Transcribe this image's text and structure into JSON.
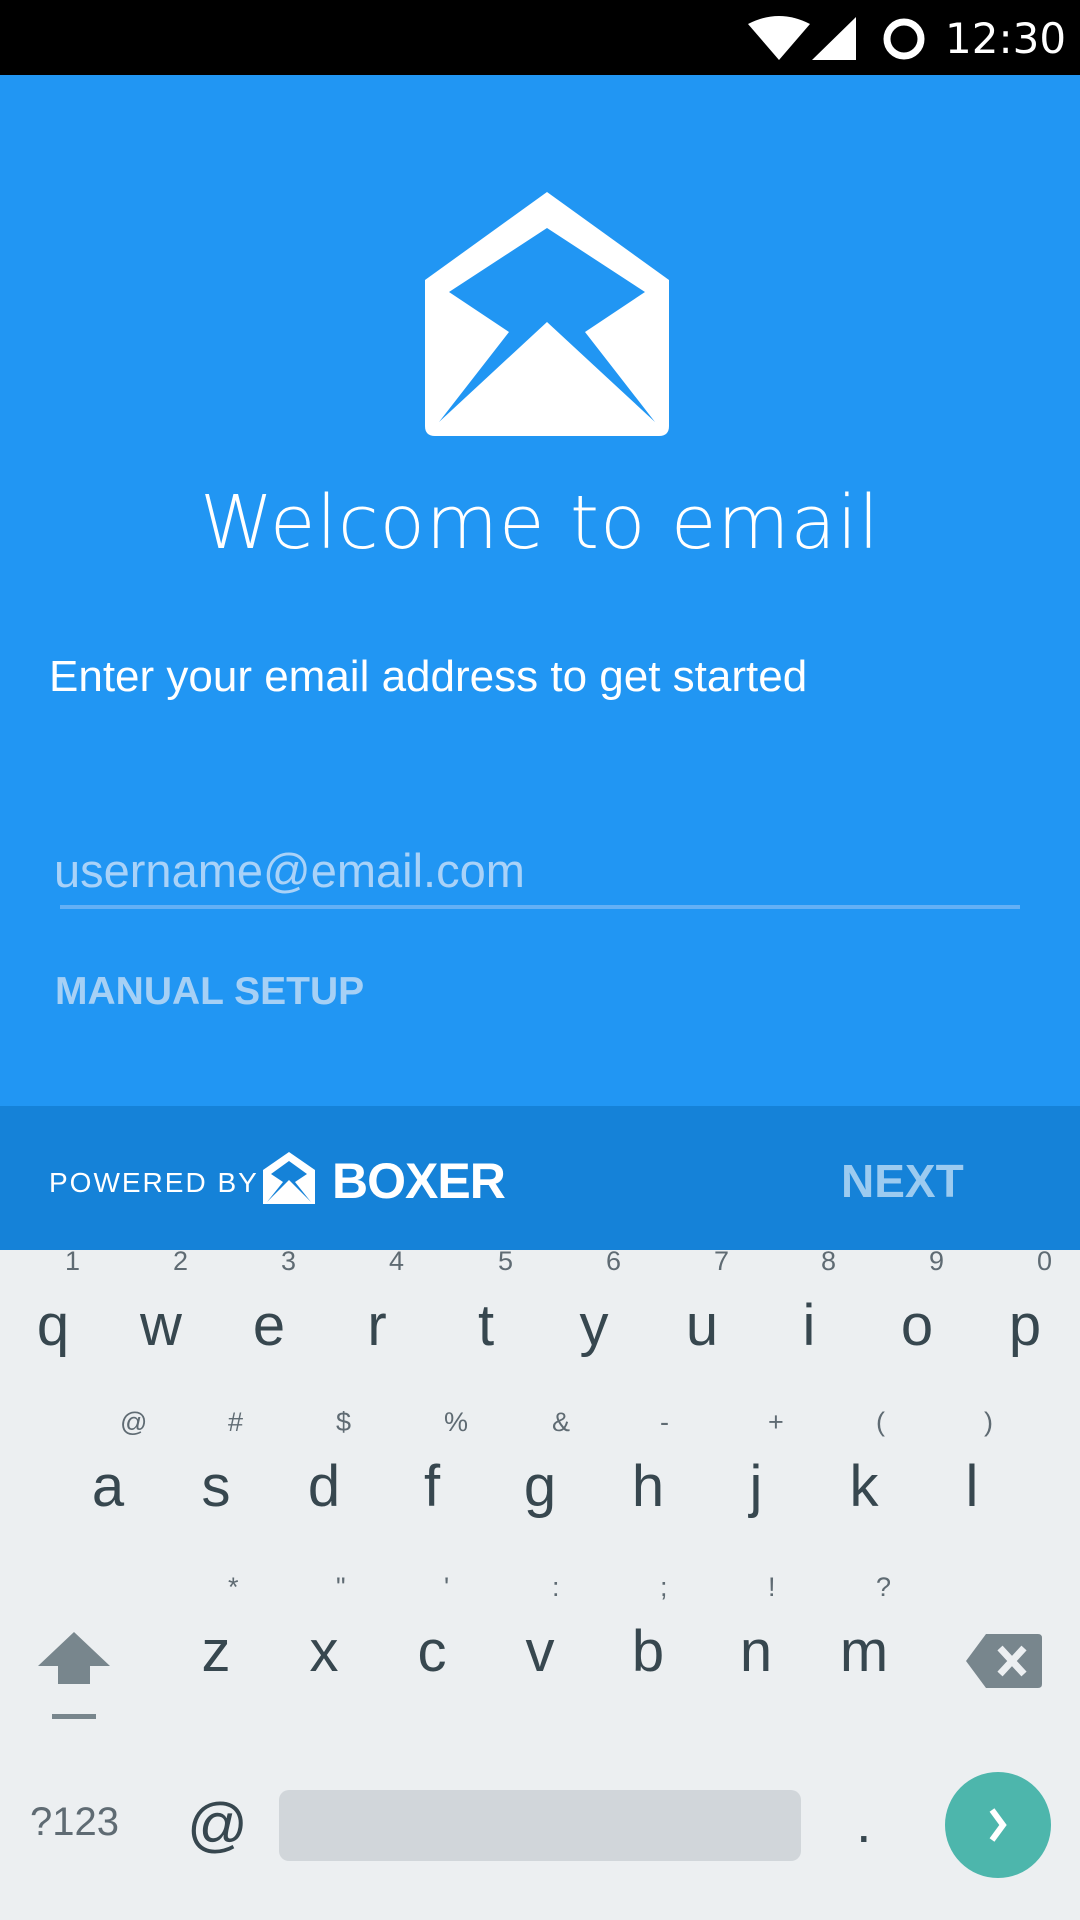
{
  "status_bar": {
    "time": "12:30",
    "icons": [
      "wifi-icon",
      "cell-signal-icon",
      "circle-icon"
    ]
  },
  "main": {
    "title": "Welcome to email",
    "subtitle": "Enter your email address to get started",
    "email_placeholder": "username@email.com",
    "manual_setup": "MANUAL SETUP"
  },
  "footer": {
    "powered_by": "POWERED BY",
    "brand": "BOXER",
    "next": "NEXT"
  },
  "keyboard": {
    "row1": [
      {
        "k": "q",
        "h": "1"
      },
      {
        "k": "w",
        "h": "2"
      },
      {
        "k": "e",
        "h": "3"
      },
      {
        "k": "r",
        "h": "4"
      },
      {
        "k": "t",
        "h": "5"
      },
      {
        "k": "y",
        "h": "6"
      },
      {
        "k": "u",
        "h": "7"
      },
      {
        "k": "i",
        "h": "8"
      },
      {
        "k": "o",
        "h": "9"
      },
      {
        "k": "p",
        "h": "0"
      }
    ],
    "row2": [
      {
        "k": "a",
        "h": "@"
      },
      {
        "k": "s",
        "h": "#"
      },
      {
        "k": "d",
        "h": "$"
      },
      {
        "k": "f",
        "h": "%"
      },
      {
        "k": "g",
        "h": "&"
      },
      {
        "k": "h",
        "h": "-"
      },
      {
        "k": "j",
        "h": "+"
      },
      {
        "k": "k",
        "h": "("
      },
      {
        "k": "l",
        "h": ")"
      }
    ],
    "row3": [
      {
        "k": "z",
        "h": "*"
      },
      {
        "k": "x",
        "h": "\""
      },
      {
        "k": "c",
        "h": "'"
      },
      {
        "k": "v",
        "h": ":"
      },
      {
        "k": "b",
        "h": ";"
      },
      {
        "k": "n",
        "h": "!"
      },
      {
        "k": "m",
        "h": "?"
      }
    ],
    "symbols": "?123",
    "at": "@",
    "period": "."
  },
  "colors": {
    "primary": "#2196F3",
    "footer": "#1582D8",
    "accent": "#4DB6AC"
  }
}
